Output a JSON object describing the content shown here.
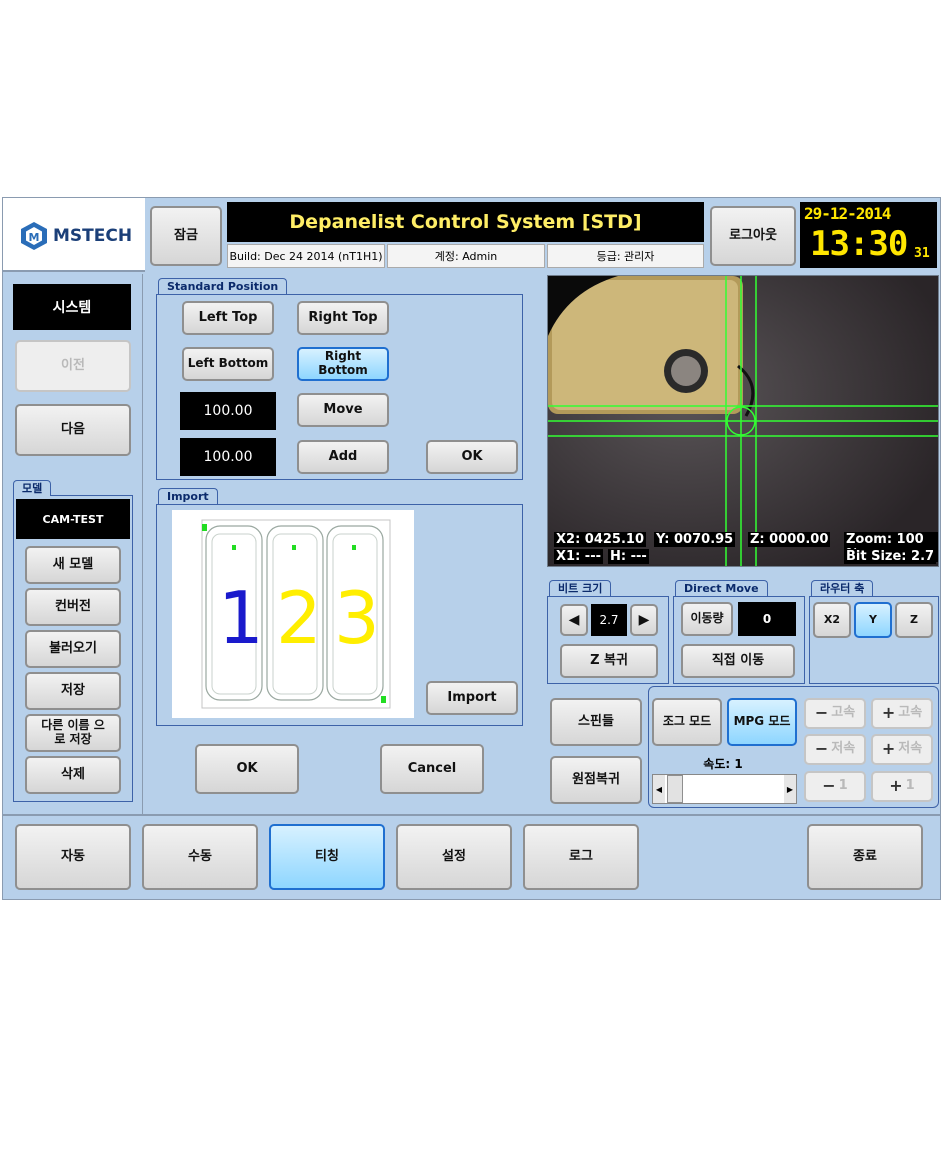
{
  "header": {
    "logo_text": "MSTECH",
    "lock_label": "잠금",
    "title": "Depanelist Control System [STD]",
    "build": "Build: Dec 24 2014 (nT1H1)",
    "account": "계정: Admin",
    "level": "등급: 관리자",
    "logout_label": "로그아웃",
    "date": "29-12-2014",
    "time": "13:30",
    "seconds": "31"
  },
  "sidebar": {
    "system_label": "시스템",
    "prev_label": "이전",
    "next_label": "다음",
    "model_group_title": "모델",
    "current_model": "CAM-TEST",
    "model_buttons": [
      "새 모델",
      "컨버전",
      "불러오기",
      "저장",
      "다른 이름 으로 저장",
      "삭제"
    ]
  },
  "standard_position": {
    "title": "Standard Position",
    "left_top": "Left Top",
    "right_top": "Right Top",
    "left_bottom": "Left Bottom",
    "right_bottom": "Right Bottom",
    "value1": "100.00",
    "value2": "100.00",
    "move": "Move",
    "add": "Add",
    "ok": "OK"
  },
  "import_panel": {
    "title": "Import",
    "import_button": "Import",
    "digits": [
      "1",
      "2",
      "3"
    ]
  },
  "dialog": {
    "ok": "OK",
    "cancel": "Cancel"
  },
  "camera": {
    "x2": "X2: 0425.10",
    "y": "Y: 0070.95",
    "z": "Z: 0000.00",
    "zoom": "Zoom: 100 %",
    "x1": "X1: ---",
    "h": "H: ---",
    "bit_size": "Bit Size: 2.7"
  },
  "bit_size_panel": {
    "title": "비트 크기",
    "value": "2.7",
    "z_return": "Z 복귀"
  },
  "direct_move": {
    "title": "Direct Move",
    "amount_label": "이동량",
    "amount_value": "0",
    "move_button": "직접 이동"
  },
  "router_axis": {
    "title": "라우터 축",
    "axes": [
      "X2",
      "Y",
      "Z"
    ]
  },
  "spindle_label": "스핀들",
  "home_label": "원점복귀",
  "jog": {
    "jog_mode": "조그 모드",
    "mpg_mode": "MPG 모드",
    "speed_label": "속도: 1",
    "minus_fast": "고속",
    "plus_fast": "고속",
    "minus_slow": "저속",
    "plus_slow": "저속",
    "minus_one": "1",
    "plus_one": "1"
  },
  "bottom_nav": {
    "auto": "자동",
    "manual": "수동",
    "teaching": "티칭",
    "settings": "설정",
    "log": "로그",
    "exit": "종료"
  },
  "colors": {
    "background": "#b7d0ea",
    "active_blue": "#8ed6ff",
    "title_yellow": "#ffee66",
    "clock_yellow": "#ffe600",
    "crosshair_green": "#33ff33",
    "digit_blue": "#1a1acc",
    "digit_yellow": "#ffee00"
  }
}
